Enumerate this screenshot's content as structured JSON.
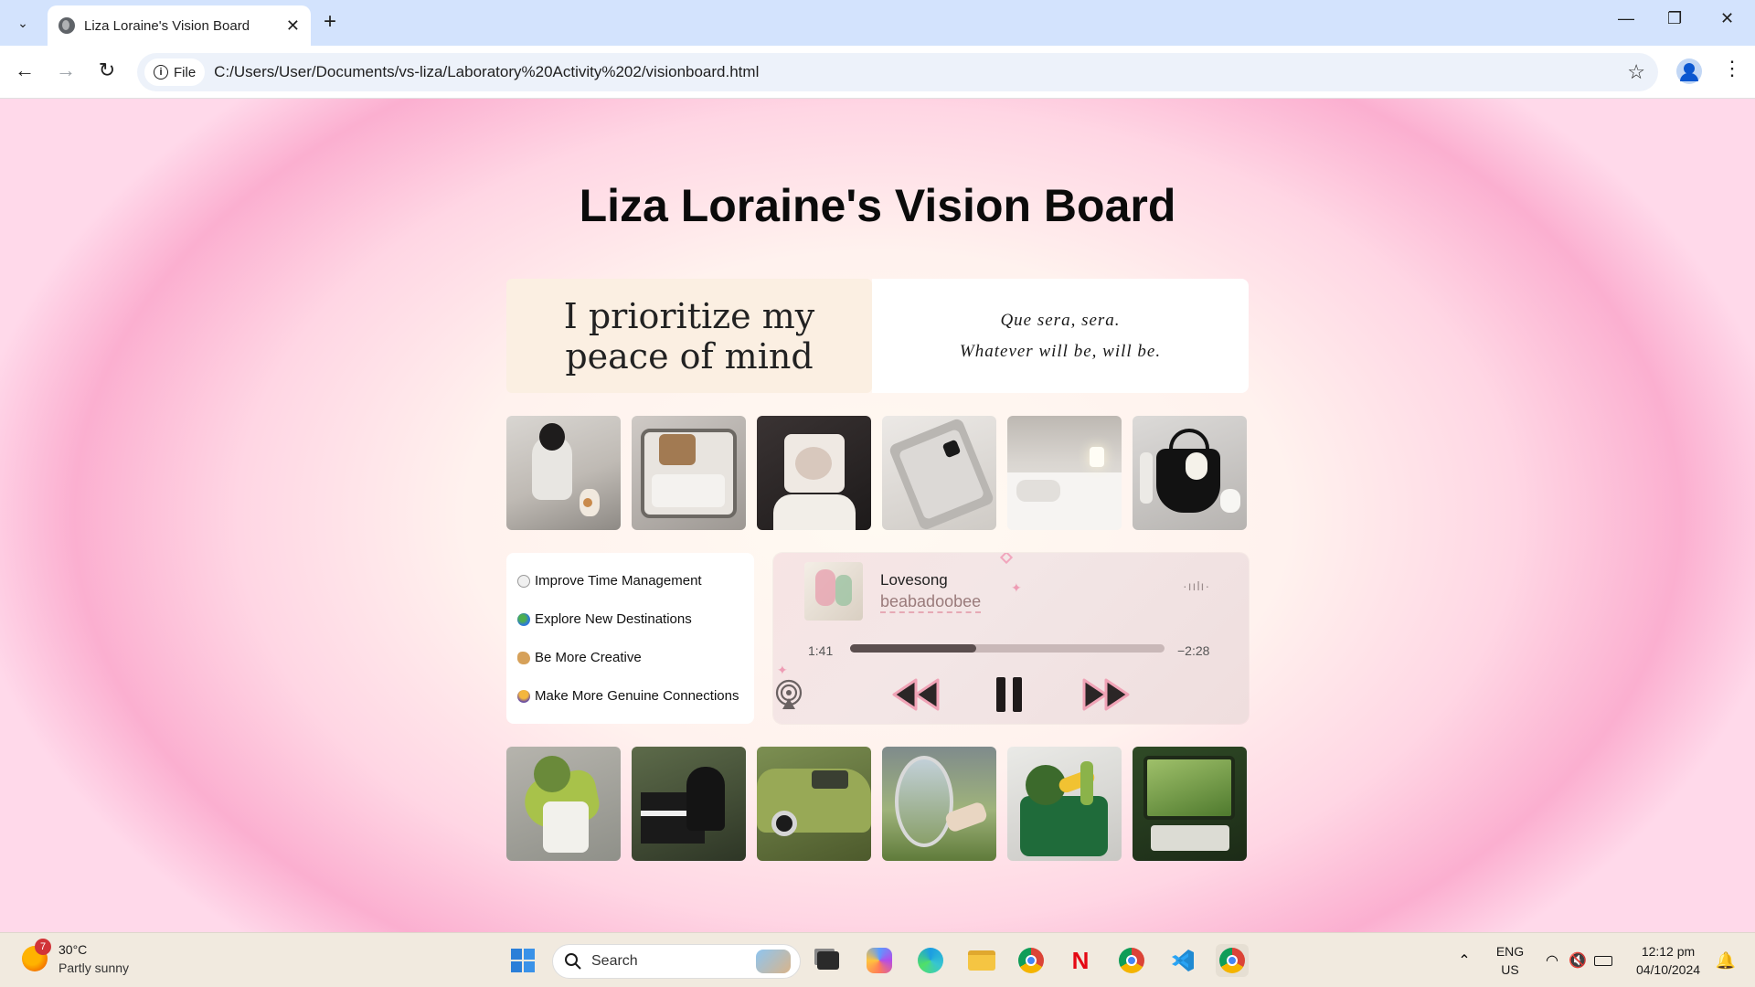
{
  "browser": {
    "tab_title": "Liza Loraine's Vision Board",
    "chip_label": "File",
    "url": "C:/Users/User/Documents/vs-liza/Laboratory%20Activity%202/visionboard.html"
  },
  "page": {
    "heading": "Liza Loraine's Vision Board",
    "quote_left": [
      "I prioritize my",
      "peace of mind"
    ],
    "quote_right": [
      "Que sera, sera.",
      "Whatever will be, will be."
    ],
    "goals": [
      {
        "icon": "clock-emoji",
        "label": "Improve Time Management"
      },
      {
        "icon": "globe-emoji",
        "label": "Explore New Destinations"
      },
      {
        "icon": "paint-palette-emoji",
        "label": "Be More Creative"
      },
      {
        "icon": "people-hugging-emoji",
        "label": "Make More Genuine Connections"
      }
    ],
    "player": {
      "song": "Lovesong",
      "artist": "beabadoobee",
      "elapsed": "1:41",
      "remaining": "−2:28",
      "progress": 0.4
    },
    "photo_row_1": [
      "girl-with-cat-photo",
      "suitcase-photo",
      "girl-with-camera-photo",
      "ipad-photo",
      "bedroom-photo",
      "tote-bag-photo"
    ],
    "photo_row_2": [
      "scooter-bouquet-photo",
      "piano-photo",
      "green-car-photo",
      "car-mirror-photo",
      "grocery-bag-photo",
      "train-window-photo"
    ]
  },
  "taskbar": {
    "weather_temp": "30°C",
    "weather_desc": "Partly sunny",
    "weather_badge": "7",
    "search_label": "Search",
    "lang_1": "ENG",
    "lang_2": "US",
    "time": "12:12 pm",
    "date": "04/10/2024"
  },
  "colors": {
    "page_pink": "#fbafd0",
    "quote_cream": "#fbefe2",
    "chrome_blue": "#d3e3fd"
  }
}
